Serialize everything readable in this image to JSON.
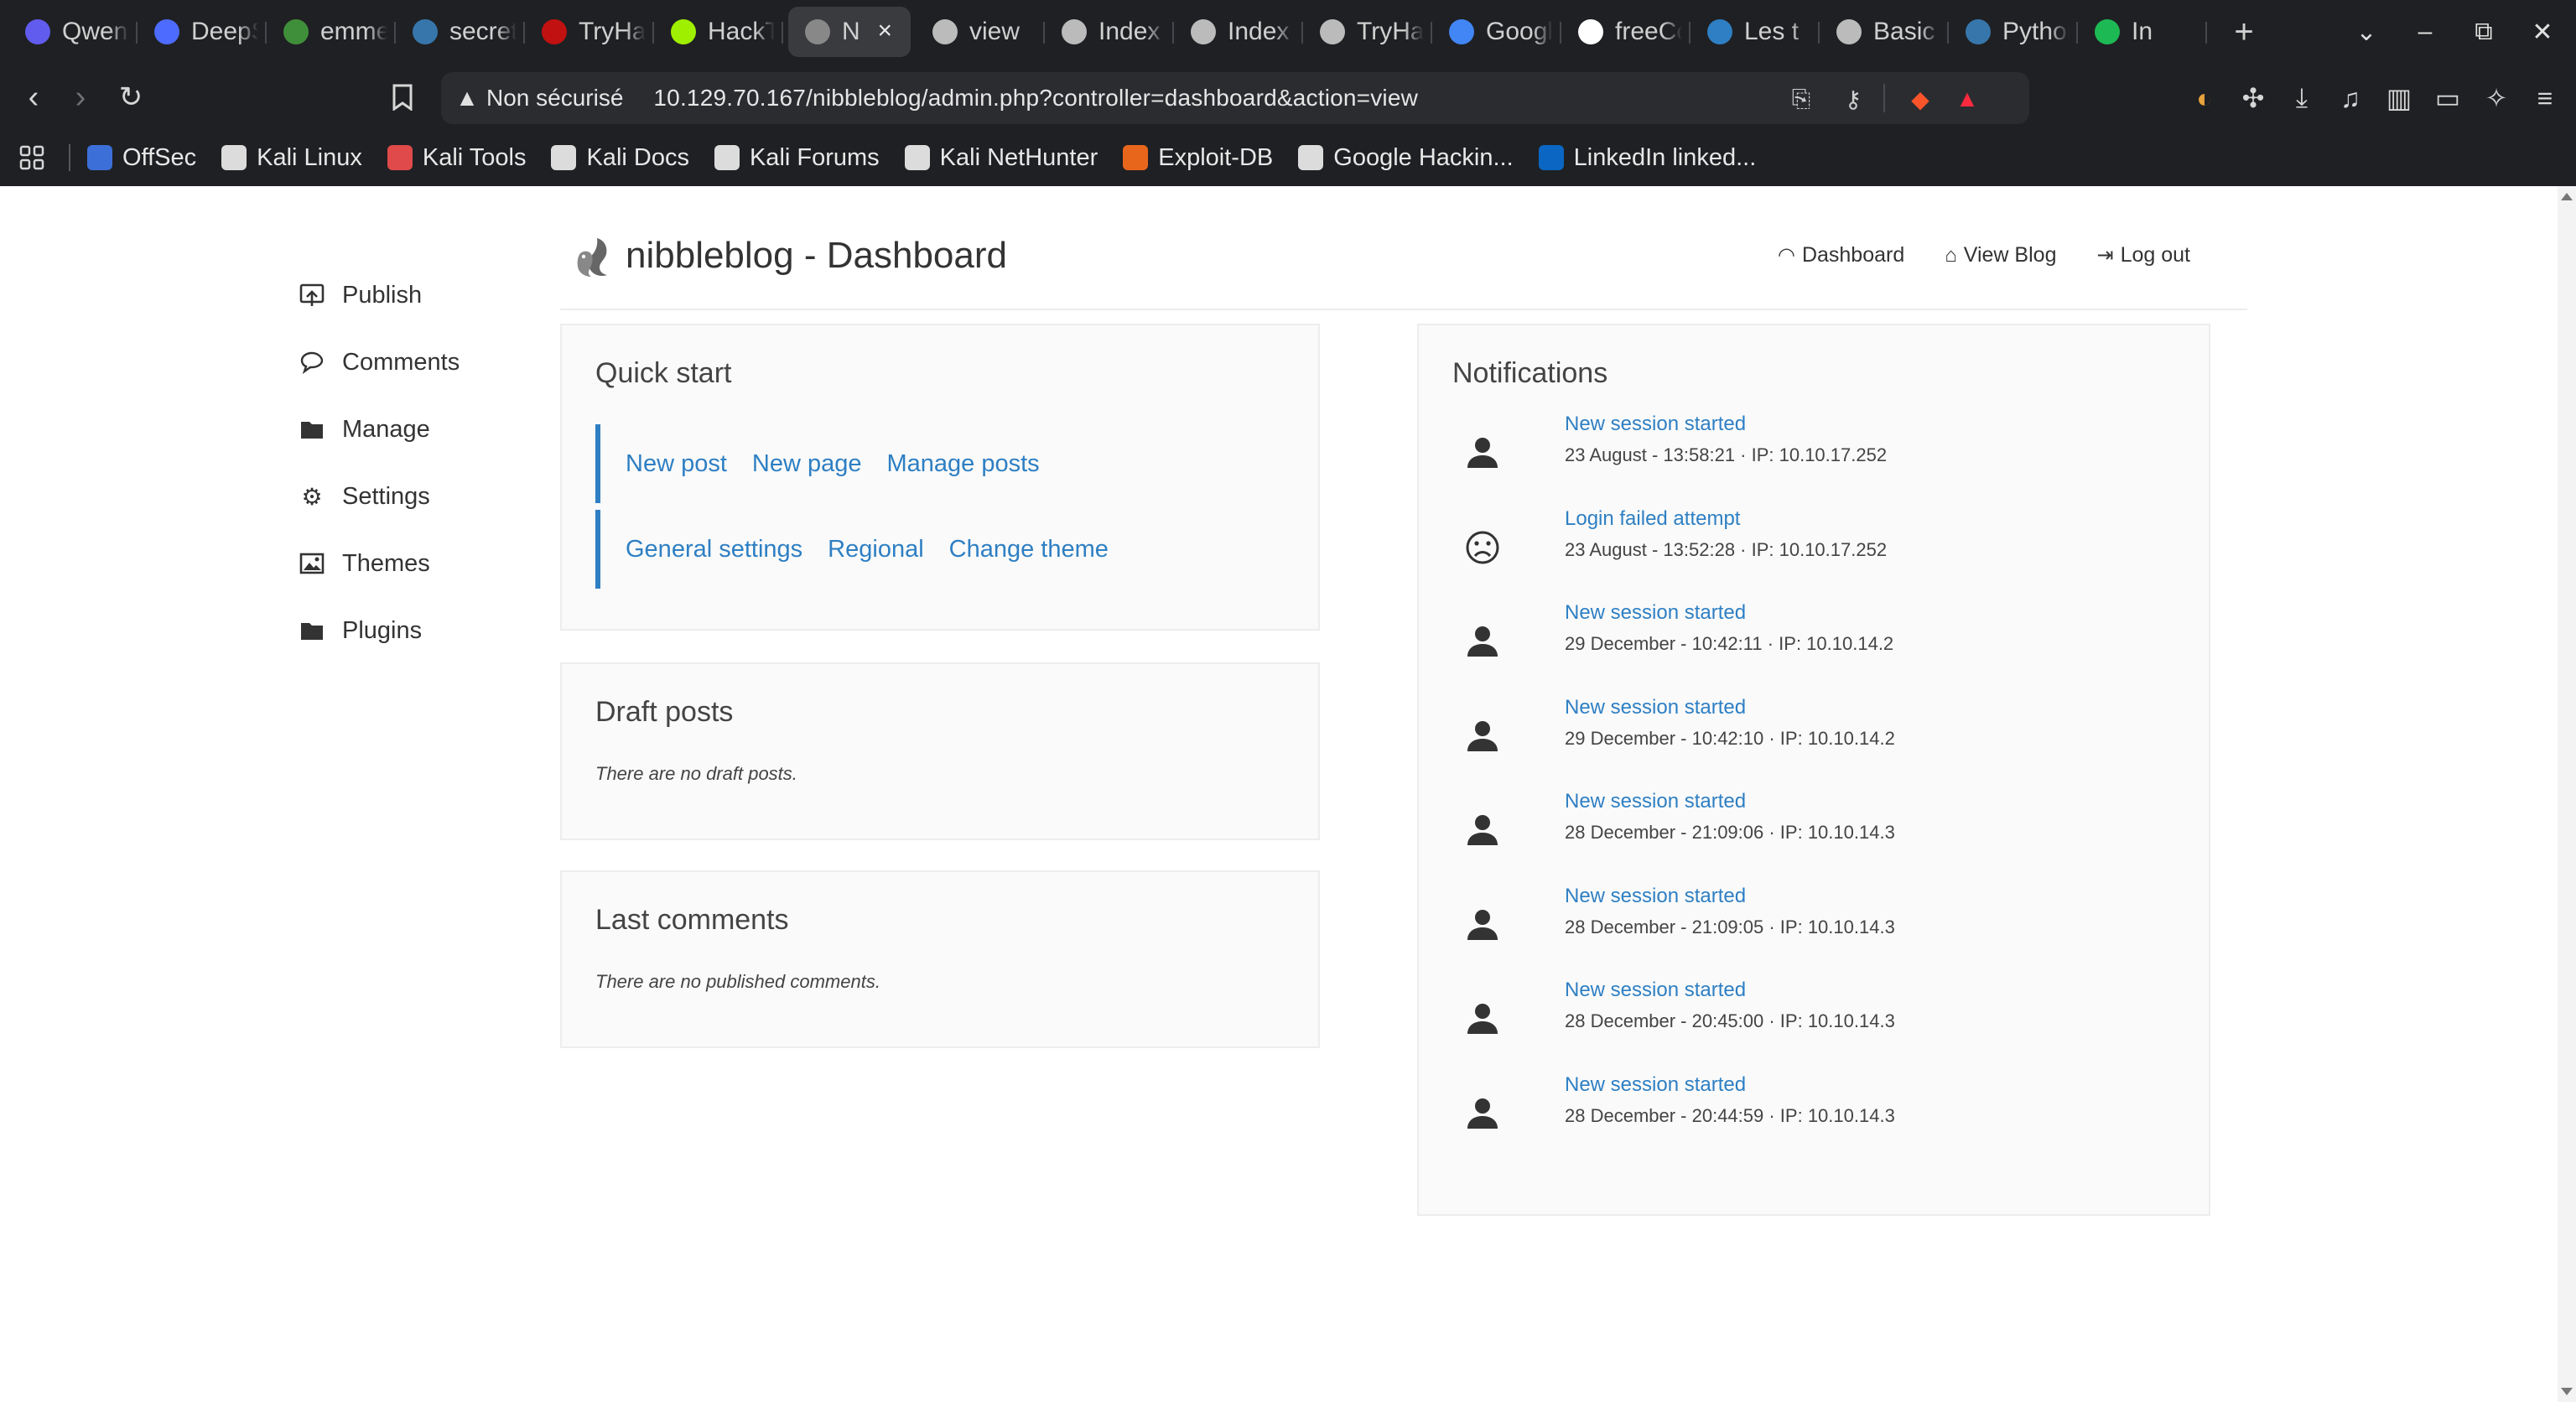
{
  "browser": {
    "tabs": [
      {
        "title": "Qwen",
        "icon": "qwen-logo-icon",
        "color": "#615ced"
      },
      {
        "title": "DeepSeek",
        "icon": "deepseek-logo-icon",
        "color": "#4d6bfe"
      },
      {
        "title": "emmet",
        "icon": "github-user-icon",
        "color": "#3f8f3a"
      },
      {
        "title": "secrets",
        "icon": "python-logo-icon",
        "color": "#3776ab"
      },
      {
        "title": "TryHackMe",
        "icon": "tryhackme-logo-icon",
        "color": "#c11111"
      },
      {
        "title": "HackTheBox",
        "icon": "hackthebox-logo-icon",
        "color": "#9fef00"
      },
      {
        "title": "N",
        "icon": "nibbleblog-favicon-icon",
        "color": "#888888",
        "active": true
      },
      {
        "title": "view",
        "icon": "globe-icon",
        "color": "#bbbbbb"
      },
      {
        "title": "Index",
        "icon": "globe-icon",
        "color": "#bbbbbb"
      },
      {
        "title": "Index",
        "icon": "globe-icon",
        "color": "#bbbbbb"
      },
      {
        "title": "TryHackMe",
        "icon": "tryhackme-room-icon",
        "color": "#bbbbbb"
      },
      {
        "title": "Google",
        "icon": "google-translate-icon",
        "color": "#4285f4"
      },
      {
        "title": "freeCodeCamp",
        "icon": "freecodecamp-logo-icon",
        "color": "#ffffff"
      },
      {
        "title": "Les t",
        "icon": "bookmark-page-icon",
        "color": "#2e7fc3"
      },
      {
        "title": "Basic",
        "icon": "globe-icon",
        "color": "#bbbbbb"
      },
      {
        "title": "Python",
        "icon": "python-logo-icon",
        "color": "#3776ab"
      },
      {
        "title": "In",
        "icon": "spotify-icon",
        "color": "#1db954"
      }
    ],
    "new_tab_label": "+",
    "security_label": "Non sécurisé",
    "url": "10.129.70.167/nibbleblog/admin.php?controller=dashboard&action=view",
    "bookmarks": [
      {
        "label": "OffSec",
        "icon": "offsec-logo-icon",
        "color": "#3c6fd8"
      },
      {
        "label": "Kali Linux",
        "icon": "kali-dragon-icon",
        "color": "#dcdcdc"
      },
      {
        "label": "Kali Tools",
        "icon": "kali-tools-icon",
        "color": "#e04a4a"
      },
      {
        "label": "Kali Docs",
        "icon": "kali-dragon-icon",
        "color": "#dcdcdc"
      },
      {
        "label": "Kali Forums",
        "icon": "globe-icon",
        "color": "#dcdcdc"
      },
      {
        "label": "Kali NetHunter",
        "icon": "kali-dragon-icon",
        "color": "#dcdcdc"
      },
      {
        "label": "Exploit-DB",
        "icon": "exploit-db-icon",
        "color": "#e8661c"
      },
      {
        "label": "Google Hackin...",
        "icon": "globe-icon",
        "color": "#dcdcdc"
      },
      {
        "label": "LinkedIn linked...",
        "icon": "linkedin-icon",
        "color": "#0a66c2"
      }
    ]
  },
  "page": {
    "title": "nibbleblog - Dashboard",
    "topnav": [
      {
        "label": "Dashboard",
        "icon": "dashboard-gauge-icon"
      },
      {
        "label": "View Blog",
        "icon": "home-icon"
      },
      {
        "label": "Log out",
        "icon": "logout-icon"
      }
    ],
    "sidebar": [
      {
        "label": "Publish",
        "icon": "publish-icon"
      },
      {
        "label": "Comments",
        "icon": "comment-bubble-icon"
      },
      {
        "label": "Manage",
        "icon": "folder-icon"
      },
      {
        "label": "Settings",
        "icon": "gear-icon"
      },
      {
        "label": "Themes",
        "icon": "image-icon"
      },
      {
        "label": "Plugins",
        "icon": "folder-icon"
      }
    ],
    "quick_start": {
      "title": "Quick start",
      "row1": [
        "New post",
        "New page",
        "Manage posts"
      ],
      "row2": [
        "General settings",
        "Regional",
        "Change theme"
      ]
    },
    "draft_posts": {
      "title": "Draft posts",
      "empty_text": "There are no draft posts."
    },
    "last_comments": {
      "title": "Last comments",
      "empty_text": "There are no published comments."
    },
    "notifications": {
      "title": "Notifications",
      "items": [
        {
          "title": "New session started",
          "info": "23 August - 13:58:21 · IP: 10.10.17.252",
          "icon": "user-icon"
        },
        {
          "title": "Login failed attempt",
          "info": "23 August - 13:52:28 · IP: 10.10.17.252",
          "icon": "sad-face-icon"
        },
        {
          "title": "New session started",
          "info": "29 December - 10:42:11 · IP: 10.10.14.2",
          "icon": "user-icon"
        },
        {
          "title": "New session started",
          "info": "29 December - 10:42:10 · IP: 10.10.14.2",
          "icon": "user-icon"
        },
        {
          "title": "New session started",
          "info": "28 December - 21:09:06 · IP: 10.10.14.3",
          "icon": "user-icon"
        },
        {
          "title": "New session started",
          "info": "28 December - 21:09:05 · IP: 10.10.14.3",
          "icon": "user-icon"
        },
        {
          "title": "New session started",
          "info": "28 December - 20:45:00 · IP: 10.10.14.3",
          "icon": "user-icon"
        },
        {
          "title": "New session started",
          "info": "28 December - 20:44:59 · IP: 10.10.14.3",
          "icon": "user-icon"
        }
      ]
    },
    "colors": {
      "link": "#2e7fc3",
      "chrome_bg": "#1f2023",
      "panel_bg": "#fafafa"
    }
  }
}
